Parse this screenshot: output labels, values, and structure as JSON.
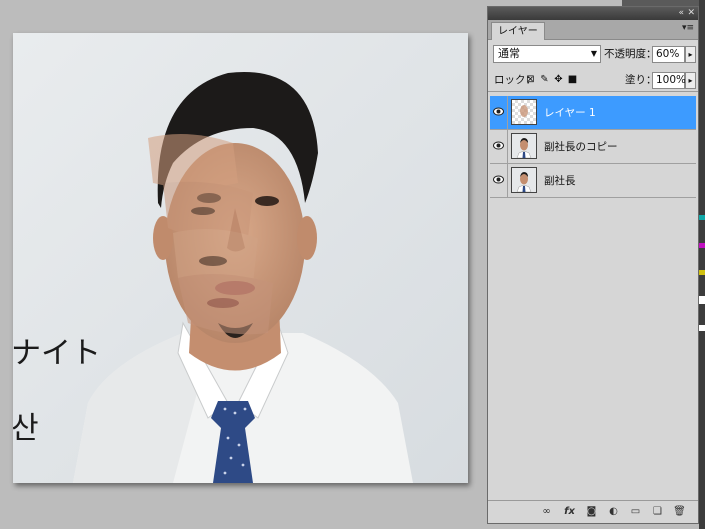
{
  "layers_panel": {
    "tab_label": "レイヤー",
    "blend_mode": "通常",
    "opacity_label": "不透明度：",
    "opacity_value": "60%",
    "lock_label": "ロック：",
    "fill_label": "塗り：",
    "fill_value": "100%",
    "layers": [
      {
        "name": "レイヤー 1",
        "selected": true,
        "visible": true
      },
      {
        "name": "副社長のコピー",
        "selected": false,
        "visible": true
      },
      {
        "name": "副社長",
        "selected": false,
        "visible": true
      }
    ]
  },
  "canvas": {
    "whiteboard_text_1": "ナイト",
    "whiteboard_text_2": "산"
  },
  "colors": {
    "selection": "#3d9bff",
    "panel_bg": "#d6d6d6",
    "workspace_bg": "#bcbcbc"
  }
}
